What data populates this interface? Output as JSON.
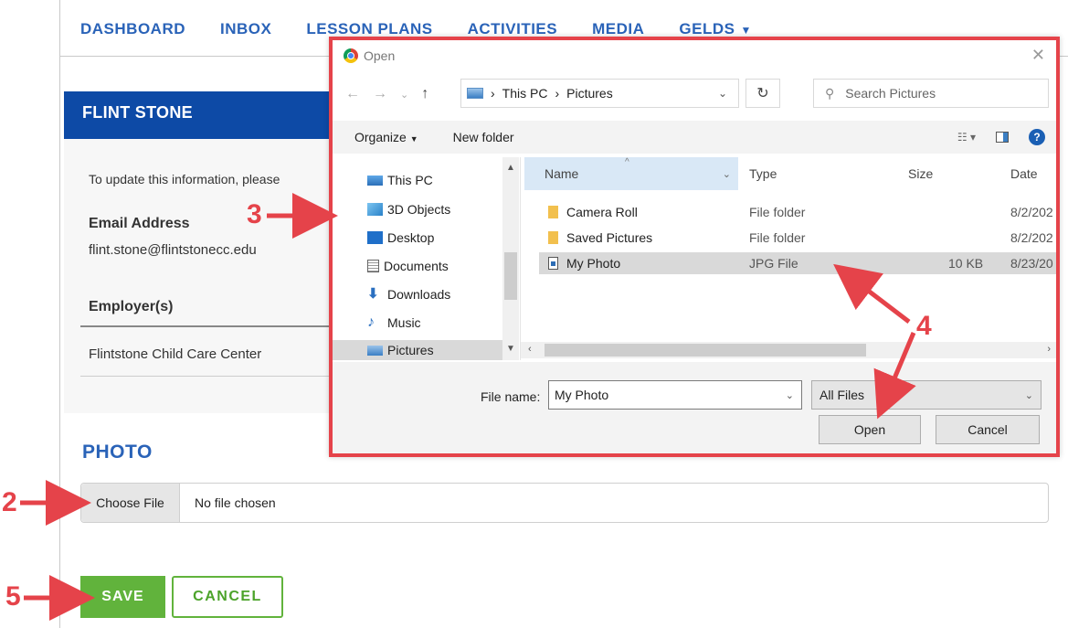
{
  "nav": {
    "items": [
      "DASHBOARD",
      "INBOX",
      "LESSON PLANS",
      "ACTIVITIES",
      "MEDIA",
      "GELDS"
    ]
  },
  "profile": {
    "name": "FLINT STONE",
    "info_text": "To update this information, please",
    "email_label": "Email Address",
    "email_value": "flint.stone@flintstonecc.edu",
    "employer_header": "Employer(s)",
    "employer_value": "Flintstone Child Care Center"
  },
  "photo": {
    "title": "PHOTO",
    "choose_label": "Choose File",
    "no_file": "No file chosen"
  },
  "actions": {
    "save_label": "SAVE",
    "cancel_label": "CANCEL"
  },
  "dialog": {
    "title": "Open",
    "path": [
      "This PC",
      "Pictures"
    ],
    "search_placeholder": "Search Pictures",
    "organize_label": "Organize",
    "new_folder_label": "New folder",
    "tree": [
      "This PC",
      "3D Objects",
      "Desktop",
      "Documents",
      "Downloads",
      "Music",
      "Pictures"
    ],
    "columns": {
      "name": "Name",
      "type": "Type",
      "size": "Size",
      "date": "Date"
    },
    "files": [
      {
        "name": "Camera Roll",
        "type": "File folder",
        "size": "",
        "date": "8/2/202"
      },
      {
        "name": "Saved Pictures",
        "type": "File folder",
        "size": "",
        "date": "8/2/202"
      },
      {
        "name": "My Photo",
        "type": "JPG File",
        "size": "10 KB",
        "date": "8/23/20"
      }
    ],
    "file_name_label": "File name:",
    "file_name_value": "My Photo",
    "file_type_value": "All Files",
    "open_label": "Open",
    "cancel_label": "Cancel"
  },
  "annotations": {
    "step2": "2",
    "step3": "3",
    "step4": "4",
    "step5": "5"
  },
  "colors": {
    "annotation": "#e5434a",
    "brand_blue": "#0d4aa6",
    "save_green": "#61b33c"
  }
}
